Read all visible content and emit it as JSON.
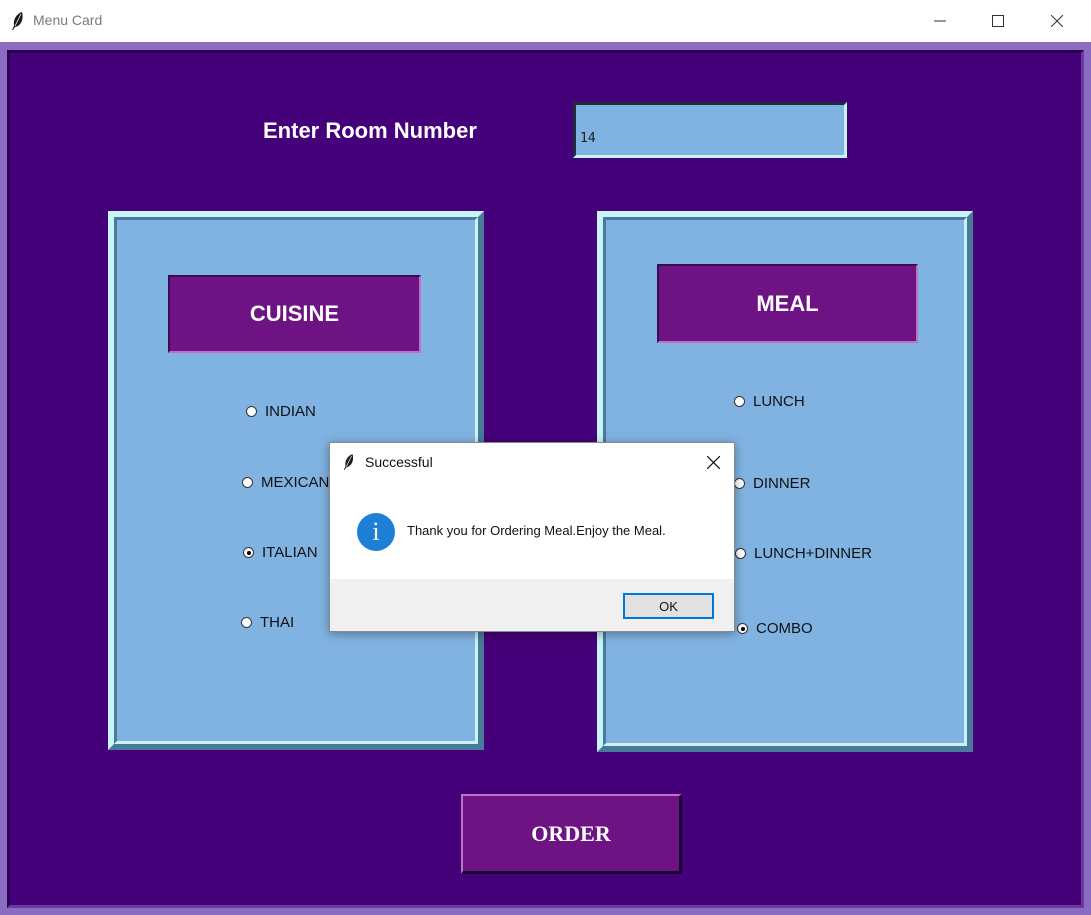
{
  "window": {
    "title": "Menu Card",
    "icon": "feather-icon"
  },
  "room": {
    "label": "Enter Room Number",
    "value": "14"
  },
  "cuisine": {
    "heading": "CUISINE",
    "options": [
      {
        "label": "INDIAN",
        "selected": false
      },
      {
        "label": "MEXICAN",
        "selected": false
      },
      {
        "label": "ITALIAN",
        "selected": true
      },
      {
        "label": "THAI",
        "selected": false
      }
    ]
  },
  "meal": {
    "heading": "MEAL",
    "options": [
      {
        "label": "LUNCH",
        "selected": false
      },
      {
        "label": "DINNER",
        "selected": false
      },
      {
        "label": "LUNCH+DINNER",
        "selected": false
      },
      {
        "label": "COMBO",
        "selected": true
      }
    ]
  },
  "order_button": "ORDER",
  "dialog": {
    "title": "Successful",
    "icon": "info-icon",
    "icon_glyph": "i",
    "message": "Thank you for Ordering Meal.Enjoy the Meal.",
    "ok_label": "OK"
  },
  "colors": {
    "background": "#45017a",
    "panel": "#80b3e2",
    "button": "#6e1383",
    "info": "#1e7fd6"
  }
}
